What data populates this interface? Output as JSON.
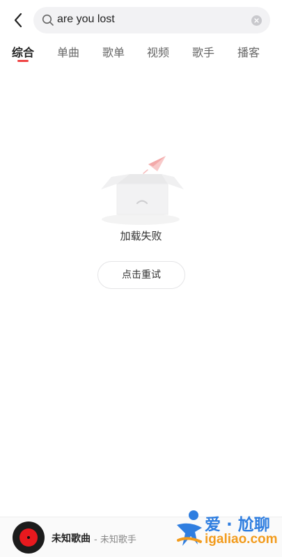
{
  "search": {
    "query": "are you lost"
  },
  "tabs": [
    {
      "label": "综合",
      "active": true
    },
    {
      "label": "单曲"
    },
    {
      "label": "歌单"
    },
    {
      "label": "视频"
    },
    {
      "label": "歌手"
    },
    {
      "label": "播客"
    }
  ],
  "empty_state": {
    "message": "加载失败",
    "retry_label": "点击重试"
  },
  "player": {
    "song_title": "未知歌曲",
    "artist": "- 未知歌手"
  },
  "watermark": {
    "line1": "爱 · 尬聊",
    "line2": "igaliao.com"
  },
  "colors": {
    "accent": "#ef4444",
    "search_bg": "#f2f2f4",
    "watermark_blue": "#2f7ee0",
    "watermark_orange": "#f29b1c"
  },
  "icons": [
    "back-arrow-icon",
    "search-icon",
    "clear-icon",
    "empty-box-icon",
    "paper-plane-icon",
    "vinyl-disc-icon"
  ]
}
